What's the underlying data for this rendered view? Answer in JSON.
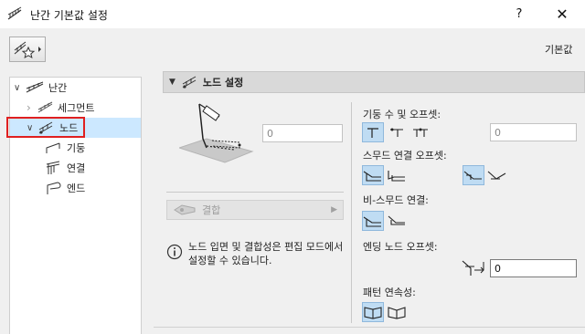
{
  "window": {
    "title": "난간 기본값 설정",
    "help_label": "?",
    "close_label": "✕"
  },
  "header": {
    "defaults_label": "기본값"
  },
  "tree": {
    "items": [
      {
        "label": "난간",
        "expand": "∨",
        "icon": "railing-icon"
      },
      {
        "label": "세그먼트",
        "expand": "›",
        "icon": "segment-icon"
      },
      {
        "label": "노드",
        "expand": "∨",
        "icon": "node-icon",
        "selected": true
      },
      {
        "label": "기둥",
        "icon": "post-icon"
      },
      {
        "label": "연결",
        "icon": "connection-icon"
      },
      {
        "label": "엔드",
        "icon": "end-icon"
      }
    ]
  },
  "panel": {
    "title": "노드 설정",
    "preview_value": "0",
    "dropdown_label": "결합",
    "info_text": "노드 입면 및 결합성은 편집 모드에서 설정할 수 있습니다.",
    "post_offset_label": "기둥 수 및 오프셋:",
    "post_offset_value": "0",
    "stair_offset_label": "스무드 연결 오프셋:",
    "non_smooth_label": "비-스무드 연결:",
    "end_node_offset_label": "엔딩 노드 오프셋:",
    "end_node_offset_value": "0",
    "pattern_label": "패턴 연속성:"
  },
  "colors": {
    "selection": "#cce8ff",
    "highlight_border": "#e02020",
    "active_button": "#bfdcf3"
  }
}
